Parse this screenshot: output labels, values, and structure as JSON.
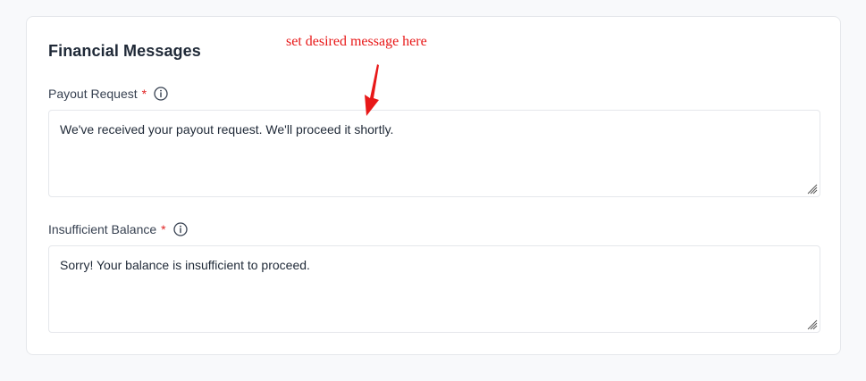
{
  "panel": {
    "title": "Financial Messages"
  },
  "annotation": {
    "text": "set desired message here",
    "color": "#e81818"
  },
  "fields": [
    {
      "label": "Payout Request",
      "required_marker": "*",
      "info_icon": "info-circle-icon",
      "value": "We've received your payout request. We'll proceed it shortly."
    },
    {
      "label": "Insufficient Balance",
      "required_marker": "*",
      "info_icon": "info-circle-icon",
      "value": "Sorry! Your balance is insufficient to proceed."
    }
  ],
  "colors": {
    "required": "#e02424",
    "border": "#e5e7eb",
    "background": "#f8f9fb"
  }
}
